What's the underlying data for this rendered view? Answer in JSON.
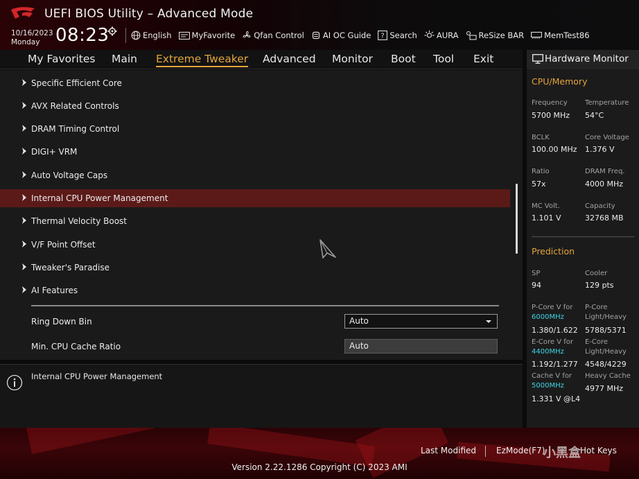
{
  "header": {
    "title": "UEFI BIOS Utility – Advanced Mode",
    "date": "10/16/2023",
    "weekday": "Monday",
    "time": "08:23",
    "toolbar": [
      {
        "label": "English",
        "icon": "globe-icon"
      },
      {
        "label": "MyFavorite",
        "icon": "favorite-icon"
      },
      {
        "label": "Qfan Control",
        "icon": "fan-icon"
      },
      {
        "label": "AI OC Guide",
        "icon": "ai-chip-icon"
      },
      {
        "label": "Search",
        "icon": "search-icon"
      },
      {
        "label": "AURA",
        "icon": "aura-icon"
      },
      {
        "label": "ReSize BAR",
        "icon": "resize-bar-icon"
      },
      {
        "label": "MemTest86",
        "icon": "memtest-icon"
      }
    ]
  },
  "tabs": [
    "My Favorites",
    "Main",
    "Extreme Tweaker",
    "Advanced",
    "Monitor",
    "Boot",
    "Tool",
    "Exit"
  ],
  "active_tab": "Extreme Tweaker",
  "menu_items": [
    "Specific Efficient Core",
    "AVX Related Controls",
    "DRAM Timing Control",
    "DIGI+ VRM",
    "Auto Voltage Caps",
    "Internal CPU Power Management",
    "Thermal Velocity Boost",
    "V/F Point Offset",
    "Tweaker's Paradise",
    "AI Features"
  ],
  "selected_item": "Internal CPU Power Management",
  "settings": {
    "ring_down_bin": {
      "label": "Ring Down Bin",
      "value": "Auto"
    },
    "min_cpu_cache_ratio": {
      "label": "Min. CPU Cache Ratio",
      "value": "Auto"
    }
  },
  "help_text": "Internal CPU Power Management",
  "hardware_monitor": {
    "title": "Hardware Monitor",
    "cpu_memory": {
      "section": "CPU/Memory",
      "frequency": {
        "label": "Frequency",
        "value": "5700 MHz"
      },
      "temperature": {
        "label": "Temperature",
        "value": "54°C"
      },
      "bclk": {
        "label": "BCLK",
        "value": "100.00 MHz"
      },
      "core_voltage": {
        "label": "Core Voltage",
        "value": "1.376 V"
      },
      "ratio": {
        "label": "Ratio",
        "value": "57x"
      },
      "dram_freq": {
        "label": "DRAM Freq.",
        "value": "4000 MHz"
      },
      "mc_volt": {
        "label": "MC Volt.",
        "value": "1.101 V"
      },
      "capacity": {
        "label": "Capacity",
        "value": "32768 MB"
      }
    },
    "prediction": {
      "section": "Prediction",
      "sp": {
        "label": "SP",
        "value": "94"
      },
      "cooler": {
        "label": "Cooler",
        "value": "129 pts"
      },
      "pcore_v": {
        "label": "P-Core V for",
        "freq": "6000MHz",
        "value": "1.380/1.622"
      },
      "pcore_lh": {
        "label1": "P-Core",
        "label2": "Light/Heavy",
        "value": "5788/5371"
      },
      "ecore_v": {
        "label": "E-Core V for",
        "freq": "4400MHz",
        "value": "1.192/1.277"
      },
      "ecore_lh": {
        "label1": "E-Core",
        "label2": "Light/Heavy",
        "value": "4548/4229"
      },
      "cache_v": {
        "label": "Cache V for",
        "freq": "5000MHz",
        "value": "1.331 V @L4"
      },
      "heavy_cache": {
        "label": "Heavy Cache",
        "value": "4977 MHz"
      }
    }
  },
  "footer": {
    "last_modified": "Last Modified",
    "ezmode": "EzMode(F7)",
    "hotkeys": "Hot Keys",
    "version": "Version 2.22.1286 Copyright (C) 2023 AMI",
    "watermark": "小黑盒"
  },
  "colors": {
    "accent": "#e4a53b",
    "selection": "#5b1a18",
    "cyan": "#3fd6e6",
    "brand_red": "#c8141c"
  }
}
